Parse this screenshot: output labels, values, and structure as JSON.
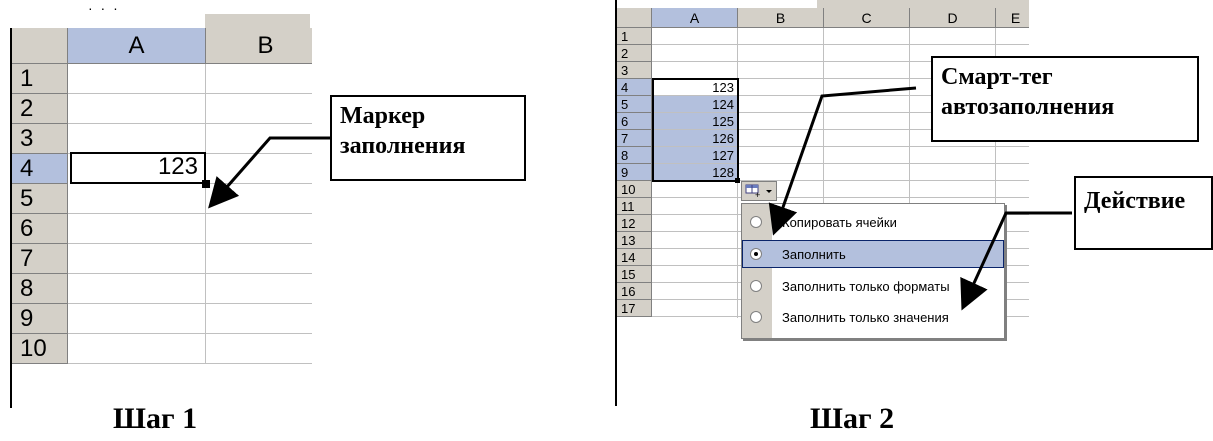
{
  "step1": {
    "caption": "Шаг 1",
    "top_dots": "· · ·",
    "columns": [
      "A",
      "B"
    ],
    "rows": [
      "1",
      "2",
      "3",
      "4",
      "5",
      "6",
      "7",
      "8",
      "9",
      "10"
    ],
    "active_cell_value": "123",
    "callout": {
      "line1": "Маркер",
      "line2": "заполнения"
    }
  },
  "step2": {
    "caption": "Шаг 2",
    "columns": [
      "A",
      "B",
      "C",
      "D",
      "E"
    ],
    "rows": [
      "1",
      "2",
      "3",
      "4",
      "5",
      "6",
      "7",
      "8",
      "9",
      "10",
      "11",
      "12",
      "13",
      "14",
      "15",
      "16",
      "17"
    ],
    "values": [
      "123",
      "124",
      "125",
      "126",
      "127",
      "128"
    ],
    "callout_smarttag": {
      "line1": "Смарт-тег",
      "line2": "автозаполнения"
    },
    "callout_action": "Действие",
    "menu": [
      {
        "label": "Копировать ячейки",
        "selected": false
      },
      {
        "label": "Заполнить",
        "selected": true
      },
      {
        "label": "Заполнить только форматы",
        "selected": false
      },
      {
        "label": "Заполнить только значения",
        "selected": false
      }
    ]
  },
  "colors": {
    "header": "#d4d0c8",
    "selection": "#b3c0dd",
    "grid": "#c0c0c0"
  }
}
